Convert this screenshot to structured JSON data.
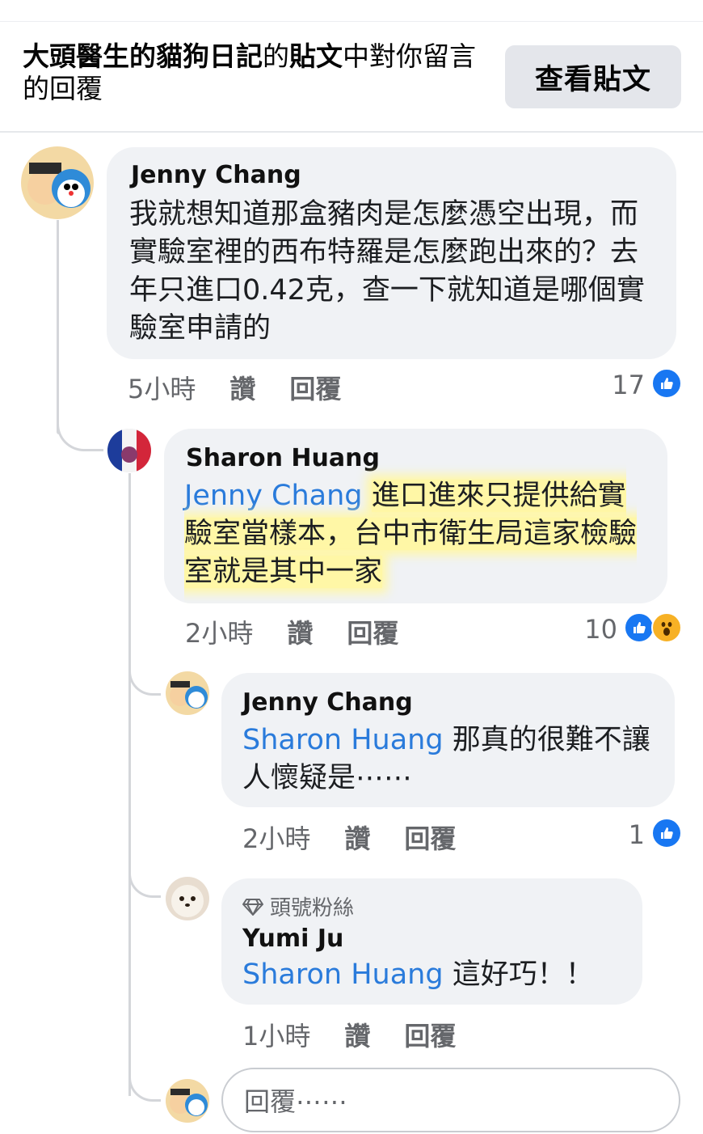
{
  "header": {
    "page_name": "大頭醫生的貓狗日記",
    "connector": "的",
    "post_word": "貼文",
    "suffix": "中對你留言的回覆",
    "view_post_button": "查看貼文"
  },
  "comments": [
    {
      "author": "Jenny Chang",
      "text": "我就想知道那盒豬肉是怎麼憑空出現，而實驗室裡的西布特羅是怎麼跑出來的？去年只進口0.42克，查一下就知道是哪個實驗室申請的",
      "time": "5小時",
      "like_label": "讚",
      "reply_label": "回覆",
      "reaction_count": "17",
      "reactions": [
        "like-icon"
      ]
    },
    {
      "author": "Sharon Huang",
      "mention": "Jenny Chang",
      "text": "進口進來只提供給實驗室當樣本，台中市衛生局這家檢驗室就是其中一家",
      "time": "2小時",
      "like_label": "讚",
      "reply_label": "回覆",
      "reaction_count": "10",
      "reactions": [
        "like-icon",
        "wow-icon"
      ]
    },
    {
      "author": "Jenny Chang",
      "mention": "Sharon Huang",
      "text": "那真的很難不讓人懷疑是⋯⋯",
      "time": "2小時",
      "like_label": "讚",
      "reply_label": "回覆",
      "reaction_count": "1",
      "reactions": [
        "like-icon"
      ]
    },
    {
      "badge": "頭號粉絲",
      "author": "Yumi Ju",
      "mention": "Sharon Huang",
      "text": "這好巧！！",
      "time": "1小時",
      "like_label": "讚",
      "reply_label": "回覆"
    }
  ],
  "reply_input": {
    "placeholder": "回覆⋯⋯"
  },
  "colors": {
    "like_blue": "#1877f2",
    "mention_blue": "#2a7bdb",
    "bubble_gray": "#f0f2f5",
    "highlight_yellow": "#fff7a6"
  }
}
